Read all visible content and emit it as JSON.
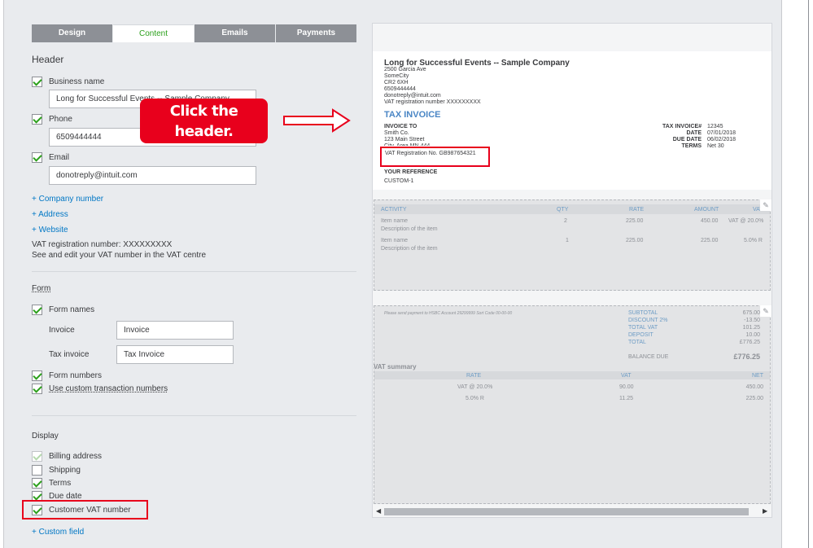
{
  "tabs": [
    {
      "label": "Design",
      "active": false
    },
    {
      "label": "Content",
      "active": true
    },
    {
      "label": "Emails",
      "active": false
    },
    {
      "label": "Payments",
      "active": false
    }
  ],
  "header_section": {
    "title": "Header",
    "business_name": {
      "label": "Business name",
      "checked": true,
      "value": "Long for Successful Events -- Sample Company"
    },
    "phone": {
      "label": "Phone",
      "checked": true,
      "value": "6509444444"
    },
    "email": {
      "label": "Email",
      "checked": true,
      "value": "donotreply@intuit.com"
    },
    "links": [
      "+ Company number",
      "+ Address",
      "+ Website"
    ],
    "vat_note_1": "VAT registration number: XXXXXXXXX",
    "vat_note_2": "See and edit your VAT number in the VAT centre"
  },
  "form_section": {
    "title": "Form",
    "form_names": {
      "label": "Form names",
      "checked": true
    },
    "invoice": {
      "label": "Invoice",
      "value": "Invoice"
    },
    "tax_invoice": {
      "label": "Tax invoice",
      "value": "Tax Invoice"
    },
    "form_numbers": {
      "label": "Form numbers",
      "checked": true
    },
    "custom_numbers": {
      "label": "Use custom transaction numbers",
      "checked": true
    }
  },
  "display_section": {
    "title": "Display",
    "items": [
      {
        "label": "Billing address",
        "checked": true,
        "disabled": true
      },
      {
        "label": "Shipping",
        "checked": false,
        "disabled": false
      },
      {
        "label": "Terms",
        "checked": true,
        "disabled": false
      },
      {
        "label": "Due date",
        "checked": true,
        "disabled": false
      },
      {
        "label": "Customer VAT number",
        "checked": true,
        "disabled": false
      }
    ],
    "custom_field_link": "+ Custom field"
  },
  "callout": {
    "line1": "Click the",
    "line2": "header."
  },
  "colors": {
    "accent_green": "#2ca01c",
    "link_blue": "#0077c5",
    "callout_red": "#e8001c",
    "tab_grey": "#8d9096"
  },
  "preview": {
    "company": "Long for Successful Events -- Sample Company",
    "address_lines": [
      "2500 Garcia Ave",
      "SomeCity",
      "CR2 6XH",
      "6509444444",
      "donotreply@intuit.com",
      "VAT registration number XXXXXXXXX"
    ],
    "doc_title": "TAX INVOICE",
    "invoice_to_label": "INVOICE TO",
    "invoice_to_lines": [
      "Smith Co.",
      "123 Main Street",
      "City, Area MN 444"
    ],
    "vat_reg": "VAT Registration No. GB987654321",
    "your_ref_label": "YOUR REFERENCE",
    "your_ref_value": "CUSTOM-1",
    "meta": [
      {
        "k": "TAX INVOICE#",
        "v": "12345"
      },
      {
        "k": "DATE",
        "v": "07/01/2018"
      },
      {
        "k": "DUE DATE",
        "v": "06/02/2018"
      },
      {
        "k": "TERMS",
        "v": "Net 30"
      }
    ],
    "table_headers": [
      "ACTIVITY",
      "QTY",
      "RATE",
      "AMOUNT",
      "VAT"
    ],
    "rows": [
      {
        "name": "Item name",
        "desc": "Description of the item",
        "qty": "2",
        "rate": "225.00",
        "amount": "450.00",
        "vat": "VAT @ 20.0%"
      },
      {
        "name": "Item name",
        "desc": "Description of the item",
        "qty": "1",
        "rate": "225.00",
        "amount": "225.00",
        "vat": "5.0% R"
      }
    ],
    "payment_note": "Please send payment to HSBC Account 29299999 Sort Code 00-00-00",
    "totals": [
      {
        "k": "SUBTOTAL",
        "v": "675.00"
      },
      {
        "k": "DISCOUNT 2%",
        "v": "-13.50"
      },
      {
        "k": "TOTAL VAT",
        "v": "101.25"
      },
      {
        "k": "DEPOSIT",
        "v": "10.00"
      },
      {
        "k": "TOTAL",
        "v": "£776.25"
      }
    ],
    "balance_label": "BALANCE DUE",
    "balance_value": "£776.25",
    "vat_summary_title": "VAT summary",
    "vat_headers": [
      "RATE",
      "VAT",
      "NET"
    ],
    "vat_rows": [
      {
        "rate": "VAT @ 20.0%",
        "vat": "90.00",
        "net": "450.00"
      },
      {
        "rate": "5.0% R",
        "vat": "11.25",
        "net": "225.00"
      }
    ]
  }
}
